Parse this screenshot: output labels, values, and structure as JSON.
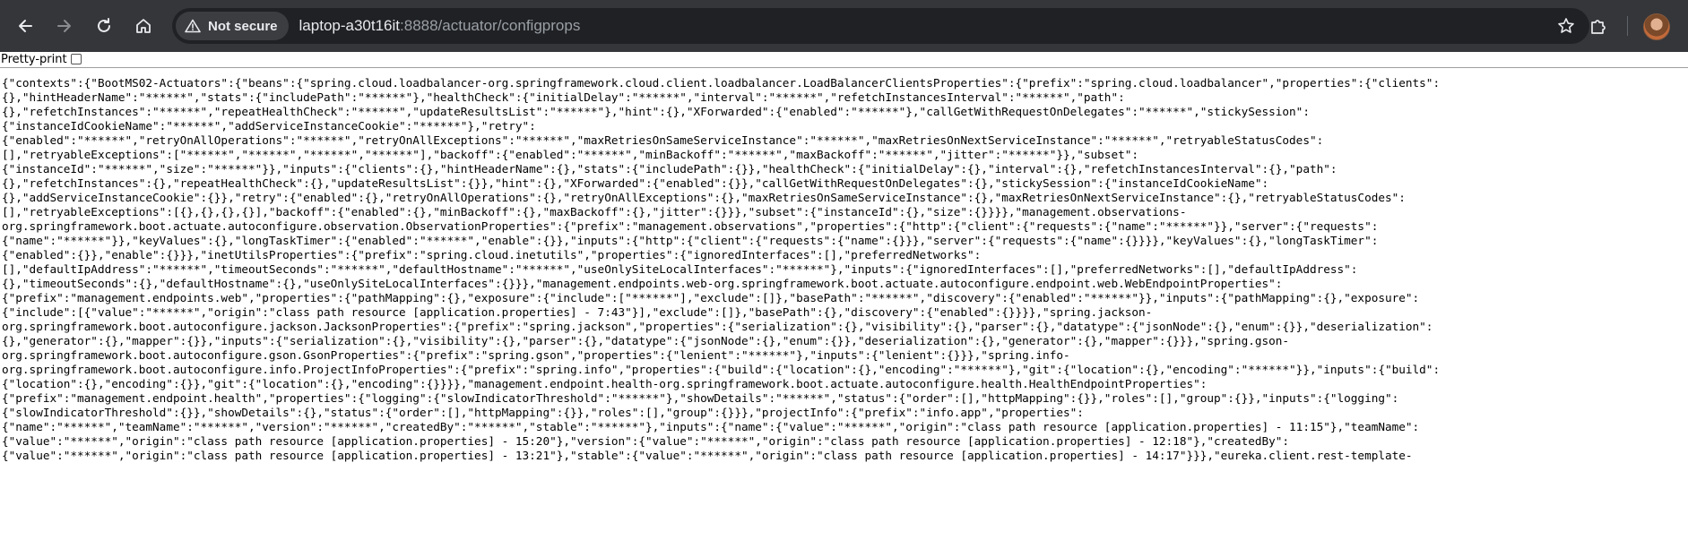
{
  "browser": {
    "security_label": "Not secure",
    "url_host": "laptop-a30t16it",
    "url_rest": ":8888/actuator/configprops"
  },
  "page": {
    "pretty_print_label": "Pretty-print",
    "json_lines": [
      "{\"contexts\":{\"BootMS02-Actuators\":{\"beans\":{\"spring.cloud.loadbalancer-org.springframework.cloud.client.loadbalancer.LoadBalancerClientsProperties\":{\"prefix\":\"spring.cloud.loadbalancer\",\"properties\":{\"clients\":",
      "{},\"hintHeaderName\":\"******\",\"stats\":{\"includePath\":\"******\"},\"healthCheck\":{\"initialDelay\":\"******\",\"interval\":\"******\",\"refetchInstancesInterval\":\"******\",\"path\":",
      "{},\"refetchInstances\":\"******\",\"repeatHealthCheck\":\"******\",\"updateResultsList\":\"******\"},\"hint\":{},\"XForwarded\":{\"enabled\":\"******\"},\"callGetWithRequestOnDelegates\":\"******\",\"stickySession\":",
      "{\"instanceIdCookieName\":\"******\",\"addServiceInstanceCookie\":\"******\"},\"retry\":",
      "{\"enabled\":\"******\",\"retryOnAllOperations\":\"******\",\"retryOnAllExceptions\":\"******\",\"maxRetriesOnSameServiceInstance\":\"******\",\"maxRetriesOnNextServiceInstance\":\"******\",\"retryableStatusCodes\":",
      "[],\"retryableExceptions\":[\"******\",\"******\",\"******\",\"******\"],\"backoff\":{\"enabled\":\"******\",\"minBackoff\":\"******\",\"maxBackoff\":\"******\",\"jitter\":\"******\"}},\"subset\":",
      "{\"instanceId\":\"******\",\"size\":\"******\"}},\"inputs\":{\"clients\":{},\"hintHeaderName\":{},\"stats\":{\"includePath\":{}},\"healthCheck\":{\"initialDelay\":{},\"interval\":{},\"refetchInstancesInterval\":{},\"path\":",
      "{},\"refetchInstances\":{},\"repeatHealthCheck\":{},\"updateResultsList\":{}},\"hint\":{},\"XForwarded\":{\"enabled\":{}},\"callGetWithRequestOnDelegates\":{},\"stickySession\":{\"instanceIdCookieName\":",
      "{},\"addServiceInstanceCookie\":{}},\"retry\":{\"enabled\":{},\"retryOnAllOperations\":{},\"retryOnAllExceptions\":{},\"maxRetriesOnSameServiceInstance\":{},\"maxRetriesOnNextServiceInstance\":{},\"retryableStatusCodes\":",
      "[],\"retryableExceptions\":[{},{},{},{}],\"backoff\":{\"enabled\":{},\"minBackoff\":{},\"maxBackoff\":{},\"jitter\":{}}},\"subset\":{\"instanceId\":{},\"size\":{}}}},\"management.observations-",
      "org.springframework.boot.actuate.autoconfigure.observation.ObservationProperties\":{\"prefix\":\"management.observations\",\"properties\":{\"http\":{\"client\":{\"requests\":{\"name\":\"******\"}},\"server\":{\"requests\":",
      "{\"name\":\"******\"}},\"keyValues\":{},\"longTaskTimer\":{\"enabled\":\"******\",\"enable\":{}},\"inputs\":{\"http\":{\"client\":{\"requests\":{\"name\":{}}},\"server\":{\"requests\":{\"name\":{}}}},\"keyValues\":{},\"longTaskTimer\":",
      "{\"enabled\":{}},\"enable\":{}}},\"inetUtilsProperties\":{\"prefix\":\"spring.cloud.inetutils\",\"properties\":{\"ignoredInterfaces\":[],\"preferredNetworks\":",
      "[],\"defaultIpAddress\":\"******\",\"timeoutSeconds\":\"******\",\"defaultHostname\":\"******\",\"useOnlySiteLocalInterfaces\":\"******\"},\"inputs\":{\"ignoredInterfaces\":[],\"preferredNetworks\":[],\"defaultIpAddress\":",
      "{},\"timeoutSeconds\":{},\"defaultHostname\":{},\"useOnlySiteLocalInterfaces\":{}}},\"management.endpoints.web-org.springframework.boot.actuate.autoconfigure.endpoint.web.WebEndpointProperties\":",
      "{\"prefix\":\"management.endpoints.web\",\"properties\":{\"pathMapping\":{},\"exposure\":{\"include\":[\"******\"],\"exclude\":[]},\"basePath\":\"******\",\"discovery\":{\"enabled\":\"******\"}},\"inputs\":{\"pathMapping\":{},\"exposure\":",
      "{\"include\":[{\"value\":\"******\",\"origin\":\"class path resource [application.properties] - 7:43\"}],\"exclude\":[]},\"basePath\":{},\"discovery\":{\"enabled\":{}}}},\"spring.jackson-",
      "org.springframework.boot.autoconfigure.jackson.JacksonProperties\":{\"prefix\":\"spring.jackson\",\"properties\":{\"serialization\":{},\"visibility\":{},\"parser\":{},\"datatype\":{\"jsonNode\":{},\"enum\":{}},\"deserialization\":",
      "{},\"generator\":{},\"mapper\":{}},\"inputs\":{\"serialization\":{},\"visibility\":{},\"parser\":{},\"datatype\":{\"jsonNode\":{},\"enum\":{}},\"deserialization\":{},\"generator\":{},\"mapper\":{}}},\"spring.gson-",
      "org.springframework.boot.autoconfigure.gson.GsonProperties\":{\"prefix\":\"spring.gson\",\"properties\":{\"lenient\":\"******\"},\"inputs\":{\"lenient\":{}}},\"spring.info-",
      "org.springframework.boot.autoconfigure.info.ProjectInfoProperties\":{\"prefix\":\"spring.info\",\"properties\":{\"build\":{\"location\":{},\"encoding\":\"******\"},\"git\":{\"location\":{},\"encoding\":\"******\"}},\"inputs\":{\"build\":",
      "{\"location\":{},\"encoding\":{}},\"git\":{\"location\":{},\"encoding\":{}}}},\"management.endpoint.health-org.springframework.boot.actuate.autoconfigure.health.HealthEndpointProperties\":",
      "{\"prefix\":\"management.endpoint.health\",\"properties\":{\"logging\":{\"slowIndicatorThreshold\":\"******\"},\"showDetails\":\"******\",\"status\":{\"order\":[],\"httpMapping\":{}},\"roles\":[],\"group\":{}},\"inputs\":{\"logging\":",
      "{\"slowIndicatorThreshold\":{}},\"showDetails\":{},\"status\":{\"order\":[],\"httpMapping\":{}},\"roles\":[],\"group\":{}}},\"projectInfo\":{\"prefix\":\"info.app\",\"properties\":",
      "{\"name\":\"******\",\"teamName\":\"******\",\"version\":\"******\",\"createdBy\":\"******\",\"stable\":\"******\"},\"inputs\":{\"name\":{\"value\":\"******\",\"origin\":\"class path resource [application.properties] - 11:15\"},\"teamName\":",
      "{\"value\":\"******\",\"origin\":\"class path resource [application.properties] - 15:20\"},\"version\":{\"value\":\"******\",\"origin\":\"class path resource [application.properties] - 12:18\"},\"createdBy\":",
      "{\"value\":\"******\",\"origin\":\"class path resource [application.properties] - 13:21\"},\"stable\":{\"value\":\"******\",\"origin\":\"class path resource [application.properties] - 14:17\"}}},\"eureka.client.rest-template-"
    ]
  }
}
